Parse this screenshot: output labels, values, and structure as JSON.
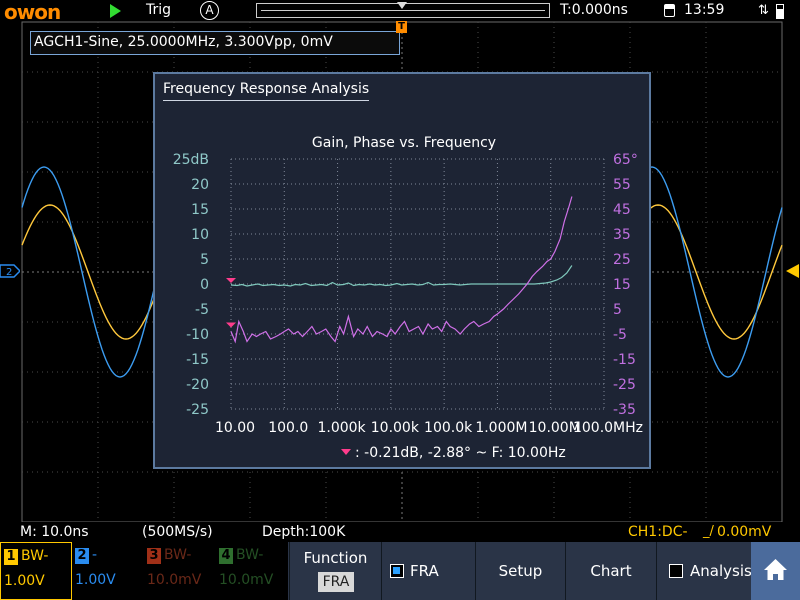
{
  "topbar": {
    "logo": "owon",
    "trigger_mode": "Trig",
    "auto_label": "A",
    "time_offset": "T:0.000ns",
    "clock": "13:59"
  },
  "awg": {
    "status": "AGCH1-Sine, 25.0000MHz, 3.300Vpp, 0mV"
  },
  "markers": {
    "trigger_position": "T",
    "ch1_level": "2"
  },
  "fra": {
    "window_title": "Frequency Response Analysis",
    "chart_data": {
      "type": "line",
      "title": "Gain, Phase vs. Frequency",
      "x_scale": "log",
      "x_tick_labels": [
        "10.00",
        "100.0",
        "1.000k",
        "10.00k",
        "100.0k",
        "1.000M",
        "10.00M",
        "100.0MHz"
      ],
      "y_left_unit": "dB",
      "y_left_ticks": [
        "25dB",
        "20",
        "15",
        "10",
        "5",
        "0",
        "-5",
        "-10",
        "-15",
        "-20",
        "-25"
      ],
      "y_left_range": [
        -25,
        25
      ],
      "y_right_ticks": [
        "65°",
        "55",
        "45",
        "35",
        "25",
        "15",
        "5",
        "-5",
        "-15",
        "-25",
        "-35"
      ],
      "y_right_range": [
        -35,
        65
      ],
      "colors": {
        "gain": "#7fc8bc",
        "phase": "#d070e8",
        "left_axis": "#8fc8c8",
        "right_axis": "#c070e0",
        "cursor": "#ff3c8c"
      },
      "series": [
        {
          "name": "Gain",
          "axis": "left",
          "x": [
            10,
            13,
            16,
            20,
            25,
            32,
            40,
            50,
            63,
            80,
            100,
            130,
            160,
            200,
            250,
            320,
            400,
            500,
            630,
            800,
            1000,
            1300,
            1600,
            2000,
            2500,
            3200,
            4000,
            5000,
            6300,
            8000,
            10000,
            13000,
            16000,
            20000,
            25000,
            32000,
            40000,
            50000,
            63000,
            80000,
            100000,
            130000,
            160000,
            200000,
            250000,
            320000,
            400000,
            500000,
            630000,
            800000,
            1000000,
            1300000,
            1600000,
            2000000,
            2500000,
            3200000,
            4000000,
            5000000,
            6300000,
            8000000,
            10000000,
            13000000,
            16000000,
            20000000,
            25000000
          ],
          "y": [
            -0.2,
            -0.3,
            -0.1,
            -0.4,
            -0.2,
            0.0,
            -0.3,
            -0.2,
            -0.1,
            -0.3,
            -0.2,
            -0.4,
            -0.1,
            -0.2,
            0.1,
            -0.3,
            -0.2,
            -0.1,
            -0.3,
            0.3,
            -0.2,
            -0.1,
            0.2,
            -0.3,
            -0.1,
            -0.2,
            0.0,
            -0.2,
            -0.1,
            -0.3,
            -0.2,
            0.1,
            -0.2,
            -0.1,
            0.0,
            -0.2,
            -0.1,
            0.3,
            -0.2,
            -0.1,
            -0.1,
            0.0,
            -0.1,
            -0.2,
            -0.1,
            0.0,
            0.0,
            0.0,
            0.0,
            0.0,
            0.0,
            0.0,
            0.0,
            0.0,
            0.0,
            0.0,
            0.0,
            0.0,
            0.1,
            0.2,
            0.4,
            0.8,
            1.3,
            2.2,
            3.7
          ]
        },
        {
          "name": "Phase",
          "axis": "right",
          "x": [
            10,
            12,
            14,
            17,
            20,
            25,
            30,
            36,
            45,
            55,
            70,
            85,
            100,
            120,
            150,
            180,
            220,
            270,
            330,
            400,
            500,
            600,
            750,
            900,
            1100,
            1300,
            1600,
            2000,
            2400,
            3000,
            3600,
            4500,
            5500,
            7000,
            8500,
            10000,
            12000,
            15000,
            18000,
            22000,
            27000,
            33000,
            40000,
            50000,
            60000,
            75000,
            90000,
            110000,
            130000,
            160000,
            200000,
            240000,
            300000,
            360000,
            450000,
            550000,
            700000,
            850000,
            1000000,
            1300000,
            1600000,
            2000000,
            2500000,
            3000000,
            3600000,
            4500000,
            5500000,
            7000000,
            8500000,
            10000000,
            12000000,
            15000000,
            18000000,
            22000000,
            25000000
          ],
          "y": [
            -4,
            -8,
            0,
            -4,
            -8,
            -5,
            -6,
            -5,
            -4,
            -7,
            -6,
            -5,
            -4,
            -3,
            -5,
            -4,
            -6,
            -4,
            -2,
            -5,
            -4,
            -3,
            -6,
            -8,
            -2,
            -5,
            2,
            -6,
            -3,
            -5,
            -2,
            -6,
            -4,
            -5,
            -6,
            -3,
            -5,
            -2,
            0,
            -4,
            -3,
            -2,
            -5,
            -1,
            -3,
            -2,
            -4,
            0,
            -2,
            -3,
            -5,
            -3,
            -1,
            0,
            -2,
            -1,
            0,
            2,
            3,
            5,
            7,
            9,
            11,
            13,
            15,
            18,
            20,
            22,
            24,
            25,
            28,
            33,
            40,
            46,
            50
          ]
        }
      ],
      "cursor_readout": ": -0.21dB, -2.88° ~ F: 10.00Hz"
    }
  },
  "waveforms": {
    "ch1_color": "#ffc83c",
    "ref_color": "#3c9cf0"
  },
  "status": {
    "timebase": "M: 10.0ns",
    "sample_rate": "(500MS/s)",
    "depth": "Depth:100K",
    "trigger": "CH1:DC-",
    "trigger_level": "0.00mV"
  },
  "channels": [
    {
      "num": "1",
      "label": "BW-",
      "value": "1.00V",
      "color": "#ffc800",
      "active": true
    },
    {
      "num": "2",
      "label": "-",
      "value": "1.00V",
      "color": "#2a8cf0",
      "active": true
    },
    {
      "num": "3",
      "label": "BW-",
      "value": "10.0mV",
      "color": "#a03018",
      "active": false
    },
    {
      "num": "4",
      "label": "BW-",
      "value": "10.0mV",
      "color": "#2f6f2f",
      "active": false
    }
  ],
  "menu": {
    "function_label": "Function",
    "function_value": "FRA",
    "fra_label": "FRA",
    "setup_label": "Setup",
    "chart_label": "Chart",
    "analysis_label": "Analysis"
  }
}
